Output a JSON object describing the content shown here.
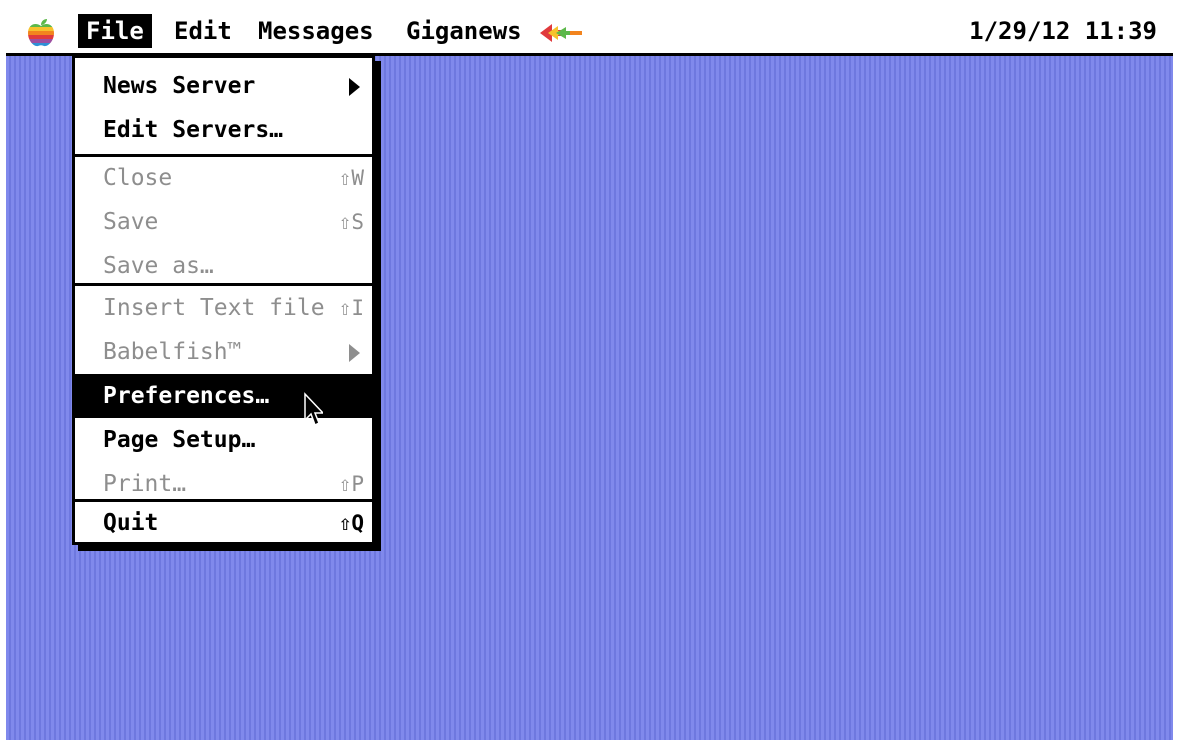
{
  "menubar": {
    "apple_icon": "apple-rainbow-icon",
    "menus": [
      "File",
      "Edit",
      "Messages",
      "Giganews"
    ],
    "giganews_icon": "giganews-logo-icon",
    "clock": "1/29/12 11:39"
  },
  "file_menu": {
    "items": {
      "news_server": {
        "label": "News Server",
        "submenu": true,
        "enabled": true
      },
      "edit_servers": {
        "label": "Edit Servers…",
        "enabled": true
      },
      "close": {
        "label": "Close",
        "shortcut": "⇧W",
        "enabled": false
      },
      "save": {
        "label": "Save",
        "shortcut": "⇧S",
        "enabled": false
      },
      "save_as": {
        "label": "Save as…",
        "enabled": false
      },
      "insert_text_file": {
        "label": "Insert Text file",
        "shortcut": "⇧I",
        "enabled": false
      },
      "babelfish": {
        "label": "Babelfish™",
        "submenu": true,
        "enabled": false
      },
      "preferences": {
        "label": "Preferences…",
        "enabled": true,
        "highlighted": true
      },
      "page_setup": {
        "label": "Page Setup…",
        "enabled": true
      },
      "print": {
        "label": "Print…",
        "shortcut": "⇧P",
        "enabled": false
      },
      "quit": {
        "label": "Quit",
        "shortcut": "⇧Q",
        "enabled": true
      }
    }
  },
  "colors": {
    "desktop": "#7a83e8",
    "menubar": "#ffffff",
    "disabled_text": "#8e8e8e",
    "highlight": "#000000"
  },
  "cursor": "arrow-pointer-icon"
}
